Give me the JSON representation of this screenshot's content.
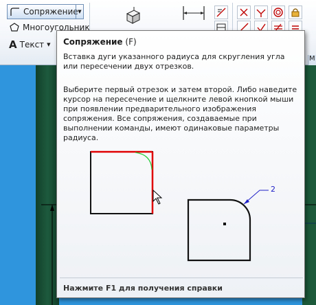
{
  "ribbon": {
    "fillet_button": {
      "label": "Сопряжение",
      "icon": "fillet-icon"
    },
    "polygon_button": {
      "label": "Многоугольник",
      "icon": "polygon-icon"
    },
    "text_button": {
      "label": "Текст",
      "icon": "text-icon",
      "glyph": "A"
    }
  },
  "tooltip": {
    "title": "Сопряжение",
    "shortcut": "(F)",
    "paragraph1": "Вставка дуги указанного радиуса для скругления угла или пересечении двух отрезков.",
    "paragraph2": "Выберите первый отрезок и затем второй. Либо наведите курсор на пересечение и щелкните левой кнопкой мыши при появлении предварительного изображения сопряжения. Все сопряжения, создаваемые при выполнении команды, имеют одинаковые параметры радиуса.",
    "illustration": {
      "callout_label": "2",
      "colors": {
        "highlight_edges": "#e00000",
        "preview_arc": "#2ecc40",
        "callout": "#2020c8"
      }
    },
    "footer": "Нажмите F1 для получения справки"
  },
  "colors": {
    "canvas": "#2f96de",
    "canvas_dark": "#1d5a3d",
    "ribbon_bg": "#f3f6fa"
  }
}
